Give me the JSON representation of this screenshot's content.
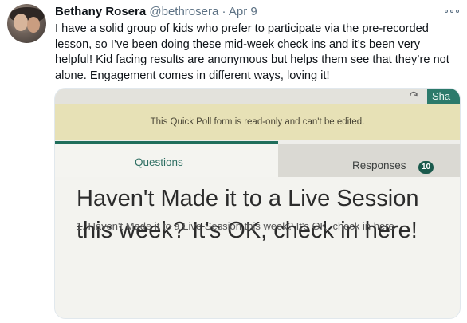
{
  "user": {
    "display_name": "Bethany Rosera",
    "handle": "@bethrosera",
    "separator": "·",
    "date": "Apr 9"
  },
  "tweet": {
    "text": "I have a solid group of kids who prefer to participate via the pre-recorded lesson, so I’ve been doing these mid-week check ins and it’s been very helpful! Kid facing results are anonymous but helps them see that they’re not alone. Engagement comes in different ways, loving it!"
  },
  "icons": {
    "more": "more-horizontal-icon",
    "refresh": "refresh-icon",
    "avatar": "profile-photo"
  },
  "photo": {
    "share_label": "Sha",
    "readonly_notice": "This Quick Poll form is read-only and can't be edited.",
    "tab_questions": "Questions",
    "tab_responses": "Responses",
    "responses_count": "10",
    "form_title": "Haven't Made it to a Live Session this week? It's OK, check in here!",
    "question_1": "1. Haven't Made it to a Live Session this week? It's OK, check in here"
  },
  "colors": {
    "name": "#0f1419",
    "meta": "#5b7083",
    "banner": "#e7e1b6",
    "accent": "#1f6e5b"
  }
}
